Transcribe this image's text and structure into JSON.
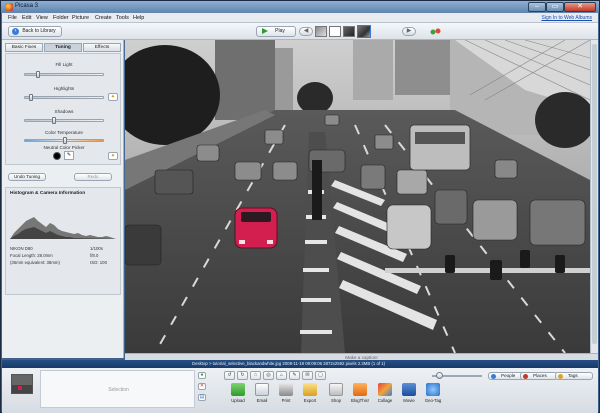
{
  "window": {
    "title": "Picasa 3",
    "min_glyph": "–",
    "max_glyph": "▭",
    "close_glyph": "✕"
  },
  "menu": {
    "items": [
      "File",
      "Edit",
      "View",
      "Folder",
      "Picture",
      "Create",
      "Tools",
      "Help"
    ],
    "sign_in": "Sign In to Web Albums"
  },
  "toolbar": {
    "back_label": "Back to Library",
    "play_label": "Play"
  },
  "left_panel": {
    "tabs": [
      "Basic Fixes",
      "Tuning",
      "Effects"
    ],
    "active_tab": "Tuning",
    "sliders": [
      {
        "label": "Fill Light",
        "value": 0.15
      },
      {
        "label": "Highlights",
        "value": 0.05
      },
      {
        "label": "Shadows",
        "value": 0.35
      },
      {
        "label": "Color Temperature",
        "value": 0.5
      }
    ],
    "neutral_label": "Neutral Color Picker",
    "undo_label": "Undo Tuning",
    "redo_label": "Redo",
    "histogram_title": "Histogram & Camera Information",
    "camera": {
      "model": "NIKON D80",
      "shutter": "1/100s",
      "focal_label": "Focal Length: 28.0mm",
      "aperture": "f/8.0",
      "equiv": "(35mm equivalent: 38mm)",
      "iso": "ISO: 100"
    }
  },
  "caption_placeholder": "Make a caption!",
  "status": {
    "text": "Desktop > tutorial_selective_blackandwhite.jpg    2008-11-18 09:09:06    3872x2592 pixels    2.3MB    (1 of 1)"
  },
  "tray": {
    "selection_label": "Selection",
    "actions": [
      "Upload",
      "Email",
      "Print",
      "Export",
      "Shop",
      "BlogThis!",
      "Collage",
      "Movie",
      "Geo-Tag"
    ],
    "pills": [
      "People",
      "Places",
      "Tags"
    ],
    "zoom_level": 0.1
  },
  "colors": {
    "status_bar": "#1f4577",
    "accent": "#3a7bd5",
    "car_red": "#d31f4f"
  }
}
